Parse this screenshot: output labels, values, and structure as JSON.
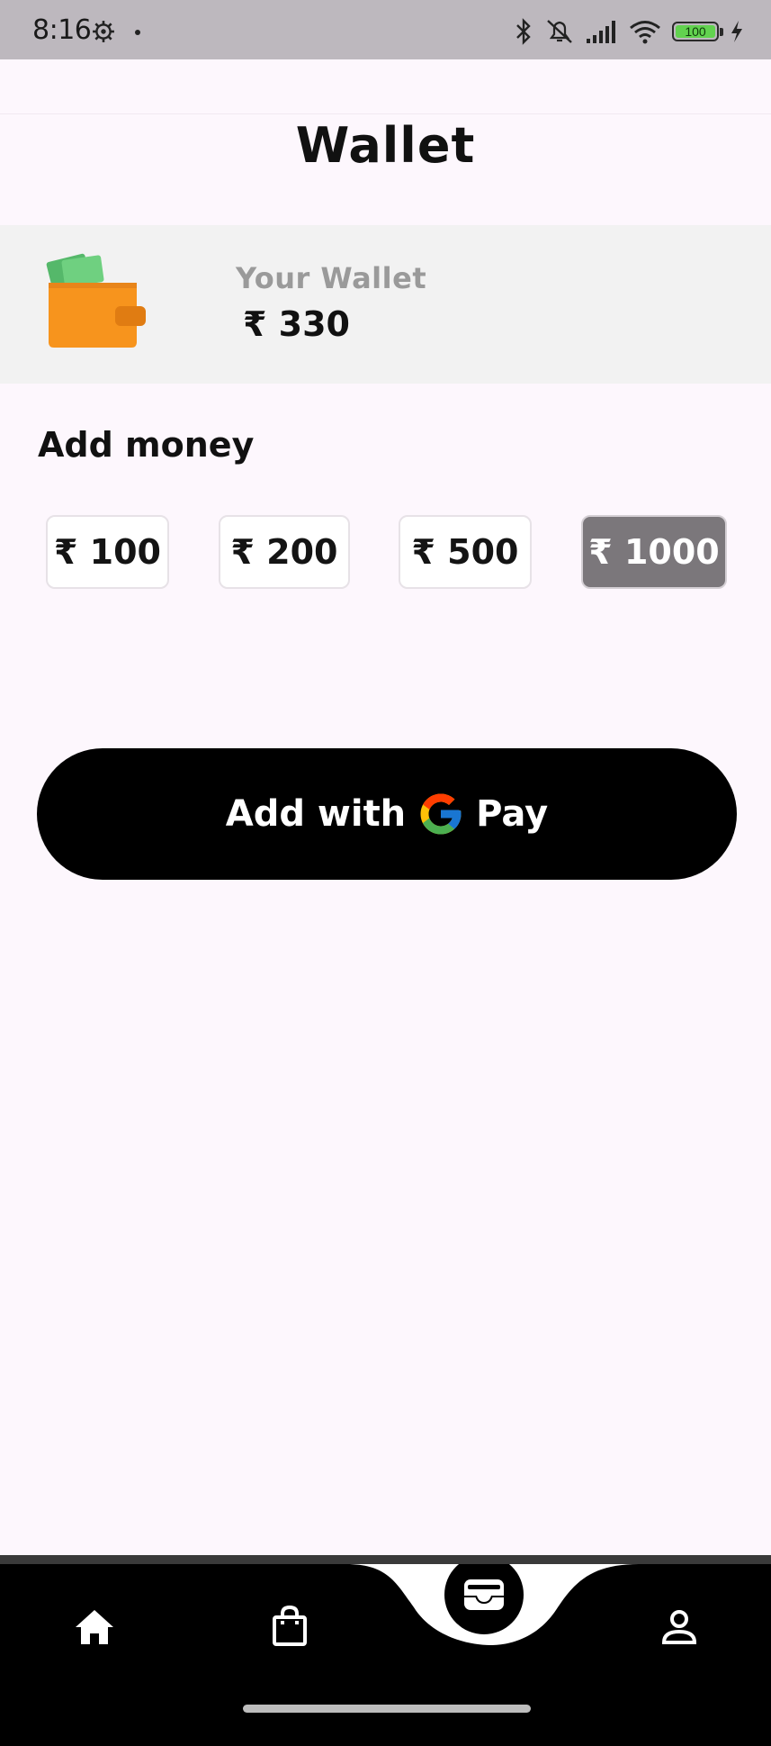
{
  "status_bar": {
    "time": "8:16",
    "battery_level": "100",
    "icons": [
      "gear-icon",
      "bluetooth-icon",
      "mute-icon",
      "signal-icon",
      "wifi-icon",
      "battery-icon",
      "charging-icon"
    ]
  },
  "header": {
    "title": "Wallet"
  },
  "wallet_card": {
    "label": "Your Wallet",
    "balance": "₹ 330",
    "icon": "wallet-icon"
  },
  "add_money": {
    "title": "Add money",
    "amounts": [
      {
        "label": "₹ 100",
        "selected": false
      },
      {
        "label": "₹ 200",
        "selected": false
      },
      {
        "label": "₹ 500",
        "selected": false
      },
      {
        "label": "₹ 1000",
        "selected": true
      }
    ]
  },
  "pay_button": {
    "prefix": "Add with",
    "suffix": "Pay",
    "icon": "google-g-icon"
  },
  "bottom_nav": {
    "items": [
      "home-icon",
      "shopping-bag-icon",
      "wallet-icon",
      "profile-icon"
    ],
    "active": "wallet-icon"
  },
  "colors": {
    "background": "#fdf7fd",
    "card": "#f2f2f2",
    "selected_chip": "#7b777b",
    "wallet_orange": "#f7941d",
    "button": "#000000"
  }
}
